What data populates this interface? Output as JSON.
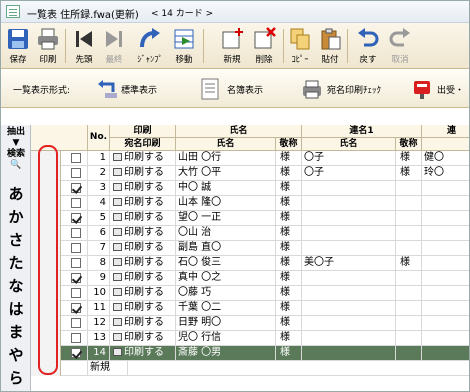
{
  "window": {
    "title": "一覧表 住所録.fwa(更新)",
    "card_count": "< 14 カード >"
  },
  "toolbar": [
    {
      "label": "保存",
      "icon": "save-icon",
      "enabled": true
    },
    {
      "label": "印刷",
      "icon": "print-icon",
      "enabled": true
    },
    {
      "label": "先頭",
      "icon": "first-icon",
      "enabled": true
    },
    {
      "label": "最終",
      "icon": "last-icon",
      "enabled": false
    },
    {
      "label": "ｼﾞｬﾝﾌﾟ",
      "icon": "jump-icon",
      "enabled": true
    },
    {
      "label": "移動",
      "icon": "move-icon",
      "enabled": true
    },
    {
      "label": "新規",
      "icon": "new-card-icon",
      "enabled": true
    },
    {
      "label": "削除",
      "icon": "delete-icon",
      "enabled": true
    },
    {
      "label": "ｺﾋﾟｰ",
      "icon": "copy-icon",
      "enabled": true
    },
    {
      "label": "貼付",
      "icon": "paste-icon",
      "enabled": true
    },
    {
      "label": "戻す",
      "icon": "undo-icon",
      "enabled": true
    },
    {
      "label": "取消",
      "icon": "redo-icon",
      "enabled": false
    }
  ],
  "viewbar": {
    "label": "一覧表示形式:",
    "standard": "標準表示",
    "meibo": "名簿表示",
    "atena": "宛名印刷ﾁｪｯｸ",
    "output": "出受・"
  },
  "sidebar": {
    "line1": "抽出",
    "line2": "検索",
    "kana": [
      "あ",
      "か",
      "さ",
      "た",
      "な",
      "は",
      "ま",
      "や",
      "ら",
      "わ"
    ]
  },
  "table": {
    "headers": {
      "no": "No.",
      "print_group": "印刷",
      "print_sub": "宛名印刷",
      "name_group": "氏名",
      "name_sub": "氏名",
      "honor": "敬称",
      "rensei_group": "連名1",
      "rensei_name": "氏名",
      "rensei_honor": "敬称",
      "overflow": "連"
    },
    "print_label": "印刷する",
    "new_row": "新規",
    "rows": [
      {
        "no": "1",
        "checked": false,
        "name": "山田 〇行",
        "honor": "様",
        "r_name": "〇子",
        "r_honor": "様",
        "extra": "健〇"
      },
      {
        "no": "2",
        "checked": false,
        "name": "大竹 〇平",
        "honor": "様",
        "r_name": "〇子",
        "r_honor": "様",
        "extra": "玲〇"
      },
      {
        "no": "3",
        "checked": true,
        "name": "中〇 誠",
        "honor": "様",
        "r_name": "",
        "r_honor": "",
        "extra": ""
      },
      {
        "no": "4",
        "checked": false,
        "name": "山本 隆〇",
        "honor": "様",
        "r_name": "",
        "r_honor": "",
        "extra": ""
      },
      {
        "no": "5",
        "checked": true,
        "name": "望〇 一正",
        "honor": "様",
        "r_name": "",
        "r_honor": "",
        "extra": ""
      },
      {
        "no": "6",
        "checked": false,
        "name": "〇山 治",
        "honor": "様",
        "r_name": "",
        "r_honor": "",
        "extra": ""
      },
      {
        "no": "7",
        "checked": false,
        "name": "副島 直〇",
        "honor": "様",
        "r_name": "",
        "r_honor": "",
        "extra": ""
      },
      {
        "no": "8",
        "checked": false,
        "name": "石〇 俊三",
        "honor": "様",
        "r_name": "美〇子",
        "r_honor": "様",
        "extra": ""
      },
      {
        "no": "9",
        "checked": true,
        "name": "真中 〇之",
        "honor": "様",
        "r_name": "",
        "r_honor": "",
        "extra": ""
      },
      {
        "no": "10",
        "checked": false,
        "name": "〇藤 巧",
        "honor": "様",
        "r_name": "",
        "r_honor": "",
        "extra": ""
      },
      {
        "no": "11",
        "checked": true,
        "name": "千葉 〇二",
        "honor": "様",
        "r_name": "",
        "r_honor": "",
        "extra": ""
      },
      {
        "no": "12",
        "checked": false,
        "name": "日野 明〇",
        "honor": "様",
        "r_name": "",
        "r_honor": "",
        "extra": ""
      },
      {
        "no": "13",
        "checked": false,
        "name": "児〇 行信",
        "honor": "様",
        "r_name": "",
        "r_honor": "",
        "extra": ""
      },
      {
        "no": "14",
        "checked": true,
        "name": "斎藤 〇男",
        "honor": "様",
        "r_name": "",
        "r_honor": "",
        "extra": ""
      }
    ]
  },
  "colors": {
    "selected_row": "#5a7a5a",
    "highlight": "#e32121",
    "header_bg": "#fbf6e6"
  }
}
